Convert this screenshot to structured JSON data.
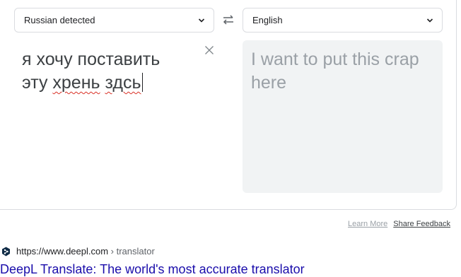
{
  "translator": {
    "source_language": "Russian detected",
    "target_language": "English",
    "source_line1": "я хочу поставить",
    "source_line2_word1": "эту",
    "source_line2_word2": "хрень",
    "source_line2_word3": "здсь",
    "target_text": "I want to put this crap here"
  },
  "footer": {
    "learn_more": "Learn More",
    "share_feedback": "Share Feedback"
  },
  "result": {
    "url": "https://www.deepl.com",
    "breadcrumb": " › translator",
    "title": "DeepL Translate: The world's most accurate translator",
    "favicon_color": "#0f2b46"
  },
  "colors": {
    "link": "#1a0dab",
    "spellcheck": "#d93025"
  }
}
